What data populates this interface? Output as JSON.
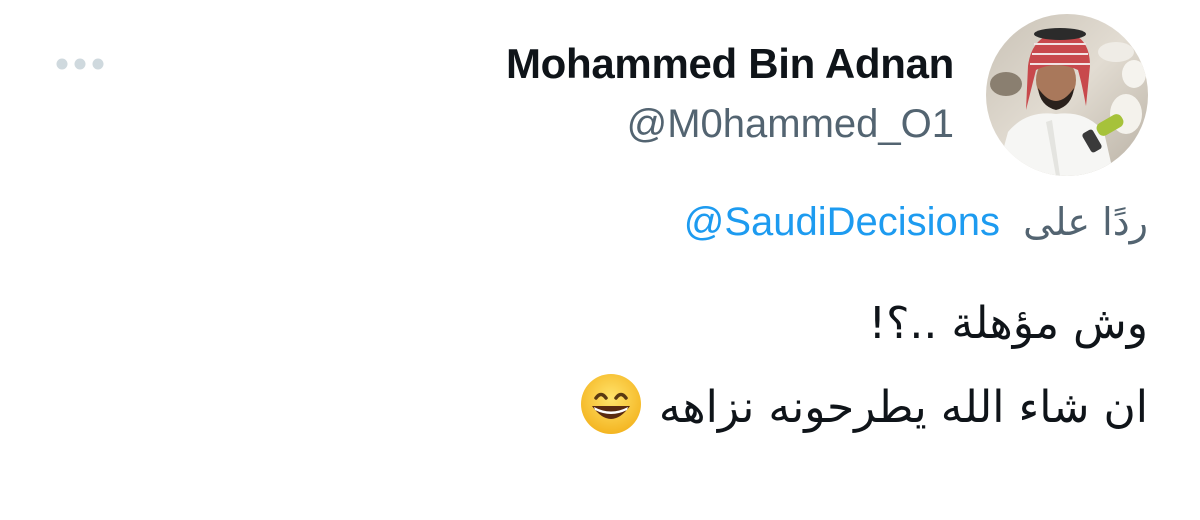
{
  "author": {
    "display_name": "Mohammed Bin Adnan",
    "handle": "@M0hammed_O1",
    "avatar_icon": "profile-photo"
  },
  "more_menu": {
    "icon": "more-horizontal-icon"
  },
  "reply": {
    "label": "ردًا على",
    "mention": "@SaudiDecisions"
  },
  "tweet": {
    "line1": "وش مؤهلة ..؟!",
    "line2": "ان شاء الله يطرحونه نزاهه",
    "emoji": "grinning-face-with-smiling-eyes"
  },
  "colors": {
    "text_primary": "#0f1419",
    "text_secondary": "#536471",
    "link": "#1d9bf0",
    "icon_muted": "#cfd9de"
  }
}
